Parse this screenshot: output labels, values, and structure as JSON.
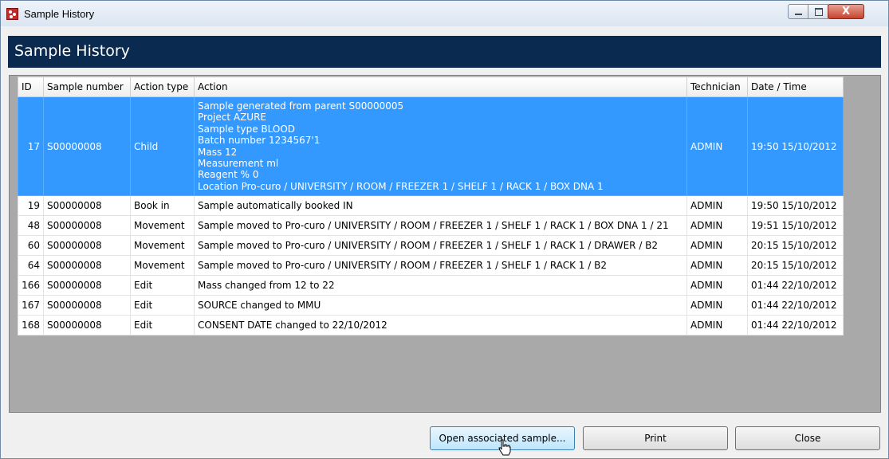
{
  "window": {
    "title": "Sample History"
  },
  "header": {
    "title": "Sample History"
  },
  "table": {
    "columns": [
      "ID",
      "Sample number",
      "Action type",
      "Action",
      "Technician",
      "Date / Time"
    ],
    "selected_row": {
      "id": "17",
      "sample_number": "S00000008",
      "action_type": "Child",
      "action_lines": [
        "Sample generated from parent S00000005",
        "Project AZURE",
        "Sample type BLOOD",
        "Batch number 1234567'1",
        "Mass 12",
        "Measurement ml",
        "Reagent % 0",
        "Location Pro-curo / UNIVERSITY / ROOM / FREEZER 1 / SHELF 1 / RACK 1 / BOX DNA 1"
      ],
      "technician": "ADMIN",
      "datetime": "19:50 15/10/2012"
    },
    "rows": [
      {
        "id": "19",
        "sample_number": "S00000008",
        "action_type": "Book in",
        "action": "Sample automatically booked IN",
        "technician": "ADMIN",
        "datetime": "19:50 15/10/2012"
      },
      {
        "id": "48",
        "sample_number": "S00000008",
        "action_type": "Movement",
        "action": "Sample moved to Pro-curo / UNIVERSITY / ROOM / FREEZER 1 / SHELF 1 / RACK 1 / BOX DNA 1 / 21",
        "technician": "ADMIN",
        "datetime": "19:51 15/10/2012"
      },
      {
        "id": "60",
        "sample_number": "S00000008",
        "action_type": "Movement",
        "action": "Sample moved to Pro-curo / UNIVERSITY / ROOM / FREEZER 1 / SHELF 1 / RACK 1 / DRAWER / B2",
        "technician": "ADMIN",
        "datetime": "20:15 15/10/2012"
      },
      {
        "id": "64",
        "sample_number": "S00000008",
        "action_type": "Movement",
        "action": "Sample moved to Pro-curo / UNIVERSITY / ROOM / FREEZER 1 / SHELF 1 / RACK 1 / B2",
        "technician": "ADMIN",
        "datetime": "20:15 15/10/2012"
      },
      {
        "id": "166",
        "sample_number": "S00000008",
        "action_type": "Edit",
        "action": "Mass changed from 12 to 22",
        "technician": "ADMIN",
        "datetime": "01:44 22/10/2012"
      },
      {
        "id": "167",
        "sample_number": "S00000008",
        "action_type": "Edit",
        "action": "SOURCE changed to MMU",
        "technician": "ADMIN",
        "datetime": "01:44 22/10/2012"
      },
      {
        "id": "168",
        "sample_number": "S00000008",
        "action_type": "Edit",
        "action": "CONSENT DATE changed to 22/10/2012",
        "technician": "ADMIN",
        "datetime": "01:44 22/10/2012"
      }
    ]
  },
  "buttons": {
    "open_associated": "Open associated sample...",
    "print": "Print",
    "close": "Close"
  },
  "titlebar_buttons": {
    "close": "X"
  },
  "colors": {
    "banner": "#0a2a4f",
    "selection": "#3399ff"
  }
}
